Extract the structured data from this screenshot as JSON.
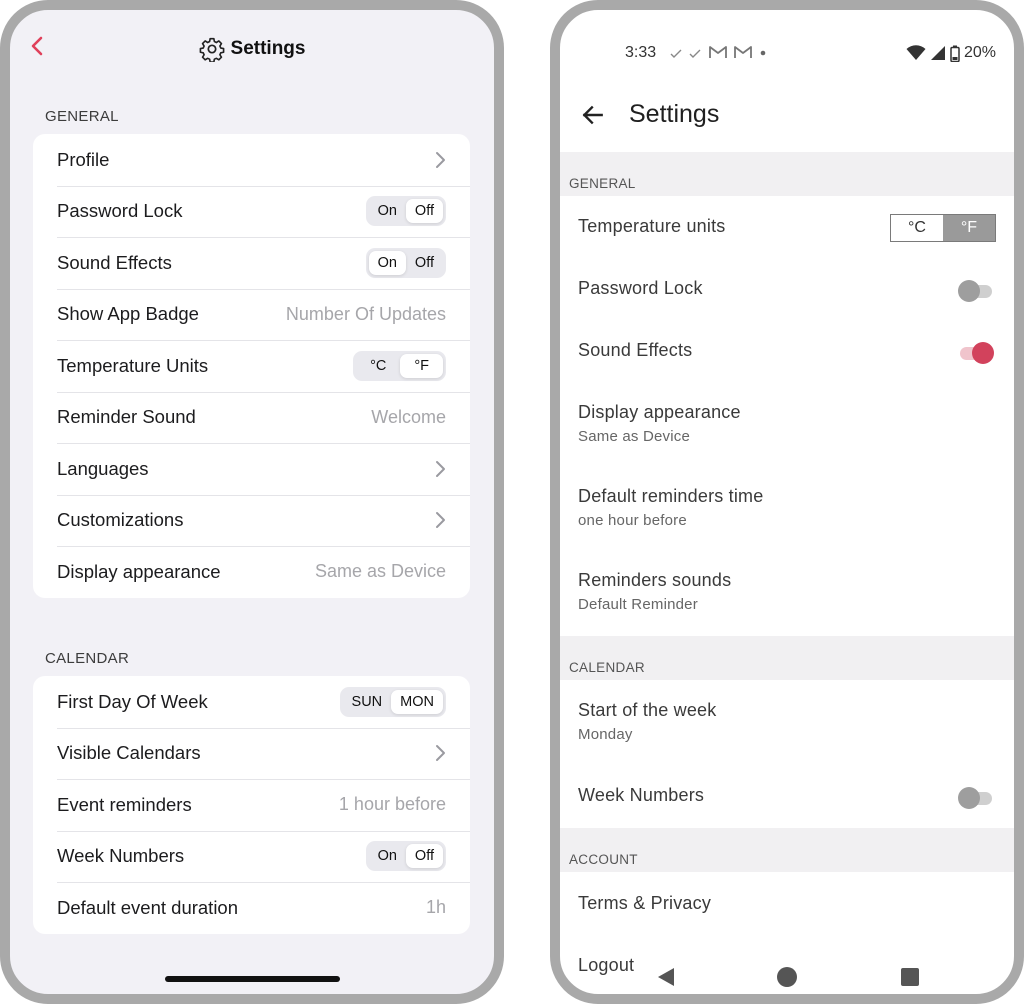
{
  "colors": {
    "ios_accent": "#e0405a",
    "ios_background": "#f2f1f6",
    "android_accent": "#d2425c",
    "android_section_bg": "#f1f0f2"
  },
  "ios": {
    "header": {
      "title": "Settings",
      "back_icon": "chevron-left-icon",
      "title_icon": "gear-icon"
    },
    "general": {
      "section_title": "GENERAL",
      "rows": [
        {
          "label": "Profile",
          "type": "chevron"
        },
        {
          "label": "Password Lock",
          "type": "segmented",
          "options": [
            "On",
            "Off"
          ],
          "selected": "Off"
        },
        {
          "label": "Sound Effects",
          "type": "segmented",
          "options": [
            "On",
            "Off"
          ],
          "selected": "On"
        },
        {
          "label": "Show App Badge",
          "type": "value",
          "value": "Number Of Updates"
        },
        {
          "label": "Temperature Units",
          "type": "segmented",
          "options": [
            "°C",
            "°F"
          ],
          "selected": "°F"
        },
        {
          "label": "Reminder Sound",
          "type": "value",
          "value": "Welcome"
        },
        {
          "label": "Languages",
          "type": "chevron"
        },
        {
          "label": "Customizations",
          "type": "chevron"
        },
        {
          "label": "Display appearance",
          "type": "value",
          "value": "Same as Device"
        }
      ]
    },
    "calendar": {
      "section_title": "CALENDAR",
      "rows": [
        {
          "label": "First Day Of Week",
          "type": "segmented",
          "options": [
            "SUN",
            "MON"
          ],
          "selected": "MON"
        },
        {
          "label": "Visible Calendars",
          "type": "chevron"
        },
        {
          "label": "Event reminders",
          "type": "value",
          "value": "1 hour before"
        },
        {
          "label": "Week Numbers",
          "type": "segmented",
          "options": [
            "On",
            "Off"
          ],
          "selected": "Off"
        },
        {
          "label": "Default event duration",
          "type": "value",
          "value": "1h"
        }
      ]
    }
  },
  "android": {
    "status_bar": {
      "time": "3:33",
      "battery": "20%"
    },
    "header": {
      "title": "Settings",
      "back_icon": "arrow-left-icon"
    },
    "general": {
      "section_title": "GENERAL",
      "temperature": {
        "label": "Temperature units",
        "options": [
          "°C",
          "°F"
        ],
        "selected": "°F"
      },
      "password_lock": {
        "label": "Password Lock",
        "on": false
      },
      "sound_effects": {
        "label": "Sound Effects",
        "on": true
      },
      "display": {
        "label": "Display appearance",
        "sub": "Same as Device"
      },
      "reminders_time": {
        "label": "Default reminders time",
        "sub": "one hour before"
      },
      "reminders_sounds": {
        "label": "Reminders sounds",
        "sub": "Default Reminder"
      }
    },
    "calendar": {
      "section_title": "CALENDAR",
      "start_week": {
        "label": "Start of the week",
        "sub": "Monday"
      },
      "week_numbers": {
        "label": "Week Numbers",
        "on": false
      }
    },
    "account": {
      "section_title": "ACCOUNT",
      "terms": "Terms & Privacy",
      "logout": "Logout"
    }
  }
}
